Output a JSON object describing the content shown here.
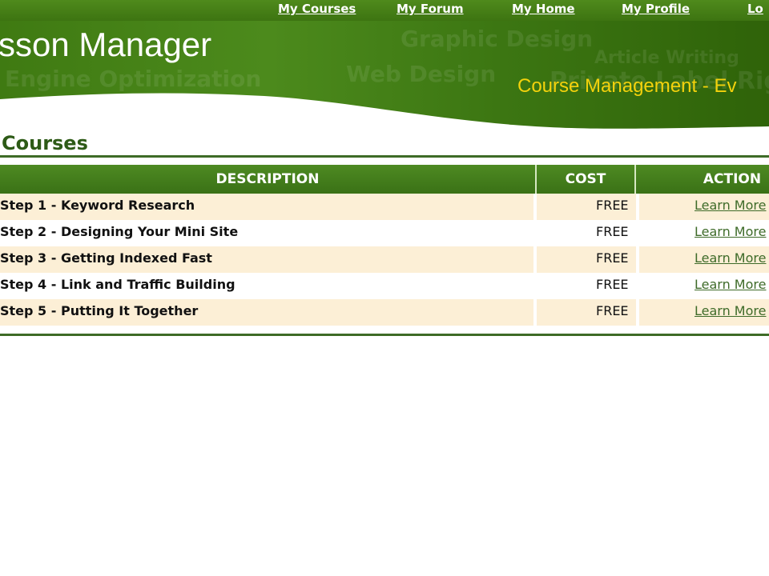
{
  "nav": {
    "items": [
      {
        "label": "My Courses"
      },
      {
        "label": "My Forum"
      },
      {
        "label": "My Home"
      },
      {
        "label": "My Profile"
      },
      {
        "label": "Lo"
      }
    ]
  },
  "banner": {
    "title": "sson Manager",
    "tagline": "Course Management - Ev",
    "watermarks": [
      "Graphic Design",
      "Article Writing",
      "Engine Optimization",
      "Web Design",
      "Private Label Rights"
    ]
  },
  "page": {
    "heading": "Courses"
  },
  "table": {
    "columns": [
      "DESCRIPTION",
      "COST",
      "ACTION"
    ],
    "rows": [
      {
        "description": "Step 1 - Keyword Research",
        "cost": "FREE",
        "action": "Learn More"
      },
      {
        "description": "Step 2 - Designing Your Mini Site",
        "cost": "FREE",
        "action": "Learn More"
      },
      {
        "description": "Step 3 - Getting Indexed Fast",
        "cost": "FREE",
        "action": "Learn More"
      },
      {
        "description": "Step 4 - Link and Traffic Building",
        "cost": "FREE",
        "action": "Learn More"
      },
      {
        "description": "Step 5 - Putting It Together",
        "cost": "FREE",
        "action": "Learn More"
      }
    ]
  },
  "colors": {
    "nav_green": "#3d7411",
    "banner_green": "#4c8a1c",
    "tagline_yellow": "#f4d20c",
    "heading_green": "#2d5a16",
    "row_alt": "#fcefd6",
    "link_green": "#3e6b29"
  }
}
